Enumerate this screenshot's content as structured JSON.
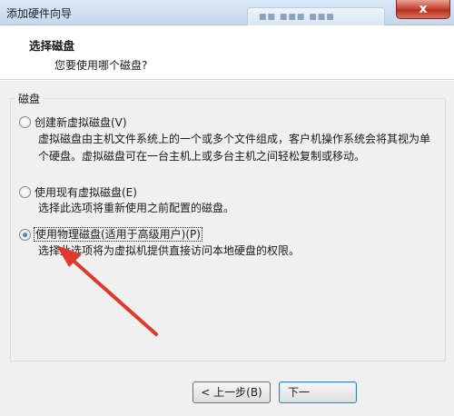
{
  "window": {
    "title": "添加硬件向导",
    "close_symbol": "x",
    "background_tab_label": "■■ ■■■ ■■■"
  },
  "header": {
    "title": "选择磁盘",
    "subtitle": "您要使用哪个磁盘?"
  },
  "group": {
    "label": "磁盘",
    "options": [
      {
        "label": "创建新虚拟磁盘(V)",
        "description_lines": [
          "虚拟磁盘由主机文件系统上的一个或多个文件组成，客户机操作系统会将其视为单",
          "个硬盘。虚拟磁盘可在一台主机上或多台主机之间轻松复制或移动。"
        ],
        "selected": false
      },
      {
        "label": "使用现有虚拟磁盘(E)",
        "description_lines": [
          "选择此选项将重新使用之前配置的磁盘。"
        ],
        "selected": false
      },
      {
        "label": "使用物理磁盘(适用于高级用户)(P)",
        "description_lines": [
          "选择此选项将为虚拟机提供直接访问本地硬盘的权限。"
        ],
        "selected": true
      }
    ]
  },
  "buttons": {
    "back": "< 上一步(B)",
    "next": "下一"
  },
  "annotation": {
    "arrow_color": "#e0392b"
  }
}
